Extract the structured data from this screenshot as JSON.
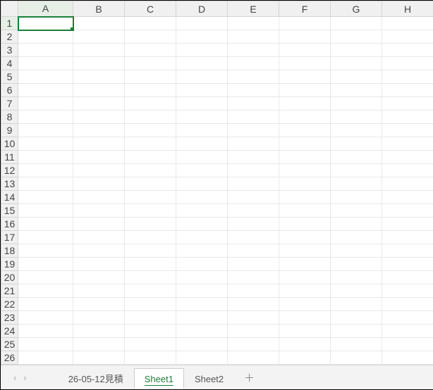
{
  "columns": [
    "A",
    "B",
    "C",
    "D",
    "E",
    "F",
    "G",
    "H"
  ],
  "rows": [
    "1",
    "2",
    "3",
    "4",
    "5",
    "6",
    "7",
    "8",
    "9",
    "10",
    "11",
    "12",
    "13",
    "14",
    "15",
    "16",
    "17",
    "18",
    "19",
    "20",
    "21",
    "22",
    "23",
    "24",
    "25",
    "26"
  ],
  "selected_cell": "A1",
  "tabbar": {
    "nav_prev": "‹",
    "nav_next": "›",
    "tabs": [
      {
        "label": "26-05-12見積",
        "active": false
      },
      {
        "label": "Sheet1",
        "active": true
      },
      {
        "label": "Sheet2",
        "active": false
      }
    ],
    "add_label": "＋"
  }
}
